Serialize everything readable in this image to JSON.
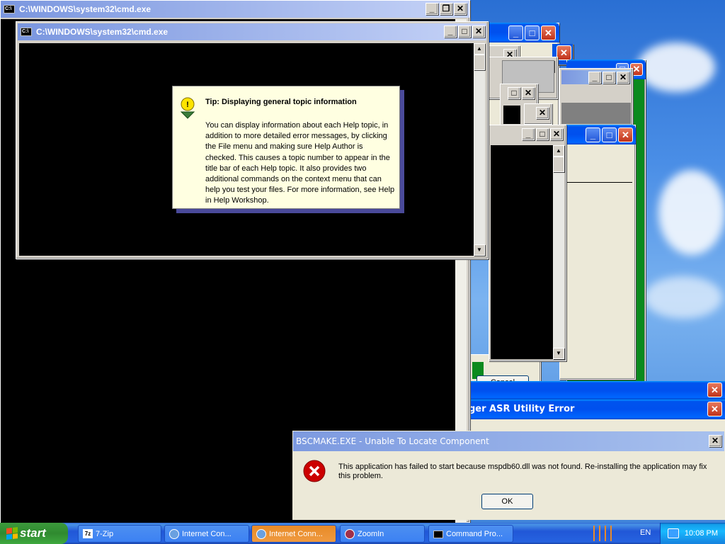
{
  "colors": {
    "error_red": "#cc0000",
    "tip_bg": "#ffffe1",
    "cmd_bg": "#000000"
  },
  "windows": {
    "back_cmd_title": "C:\\WINDOWS\\system32\\cmd.exe",
    "front_cmd_title": "C:\\WINDOWS\\system32\\cmd.exe",
    "asr_title_partial": "ger ASR Utility Error",
    "cancel_label": "Cancel"
  },
  "tip": {
    "title": "Tip: Displaying general topic information",
    "body": "You can display information about each Help topic, in addition to more detailed error messages, by clicking the File menu and making sure Help Author is checked. This causes a topic number to appear in the title bar of each Help topic. It also provides two additional commands on the context menu that can help you test your files. For more information, see Help in Help Workshop."
  },
  "error_dialog": {
    "title": "BSCMAKE.EXE - Unable To Locate Component",
    "message": "This application has failed to start because mspdb60.dll was not found. Re-installing the application may fix this problem.",
    "ok_label": "OK"
  },
  "taskbar": {
    "start_label": "start",
    "items": [
      {
        "label": "7-Zip",
        "icon": "7zip-icon"
      },
      {
        "label": "Internet Con...",
        "icon": "network-icon"
      },
      {
        "label": "Internet Conn...",
        "icon": "network-icon"
      },
      {
        "label": "ZoomIn",
        "icon": "zoom-icon"
      },
      {
        "label": "Command Pro...",
        "icon": "cmd-icon"
      }
    ],
    "language": "EN",
    "clock": "10:08 PM"
  }
}
